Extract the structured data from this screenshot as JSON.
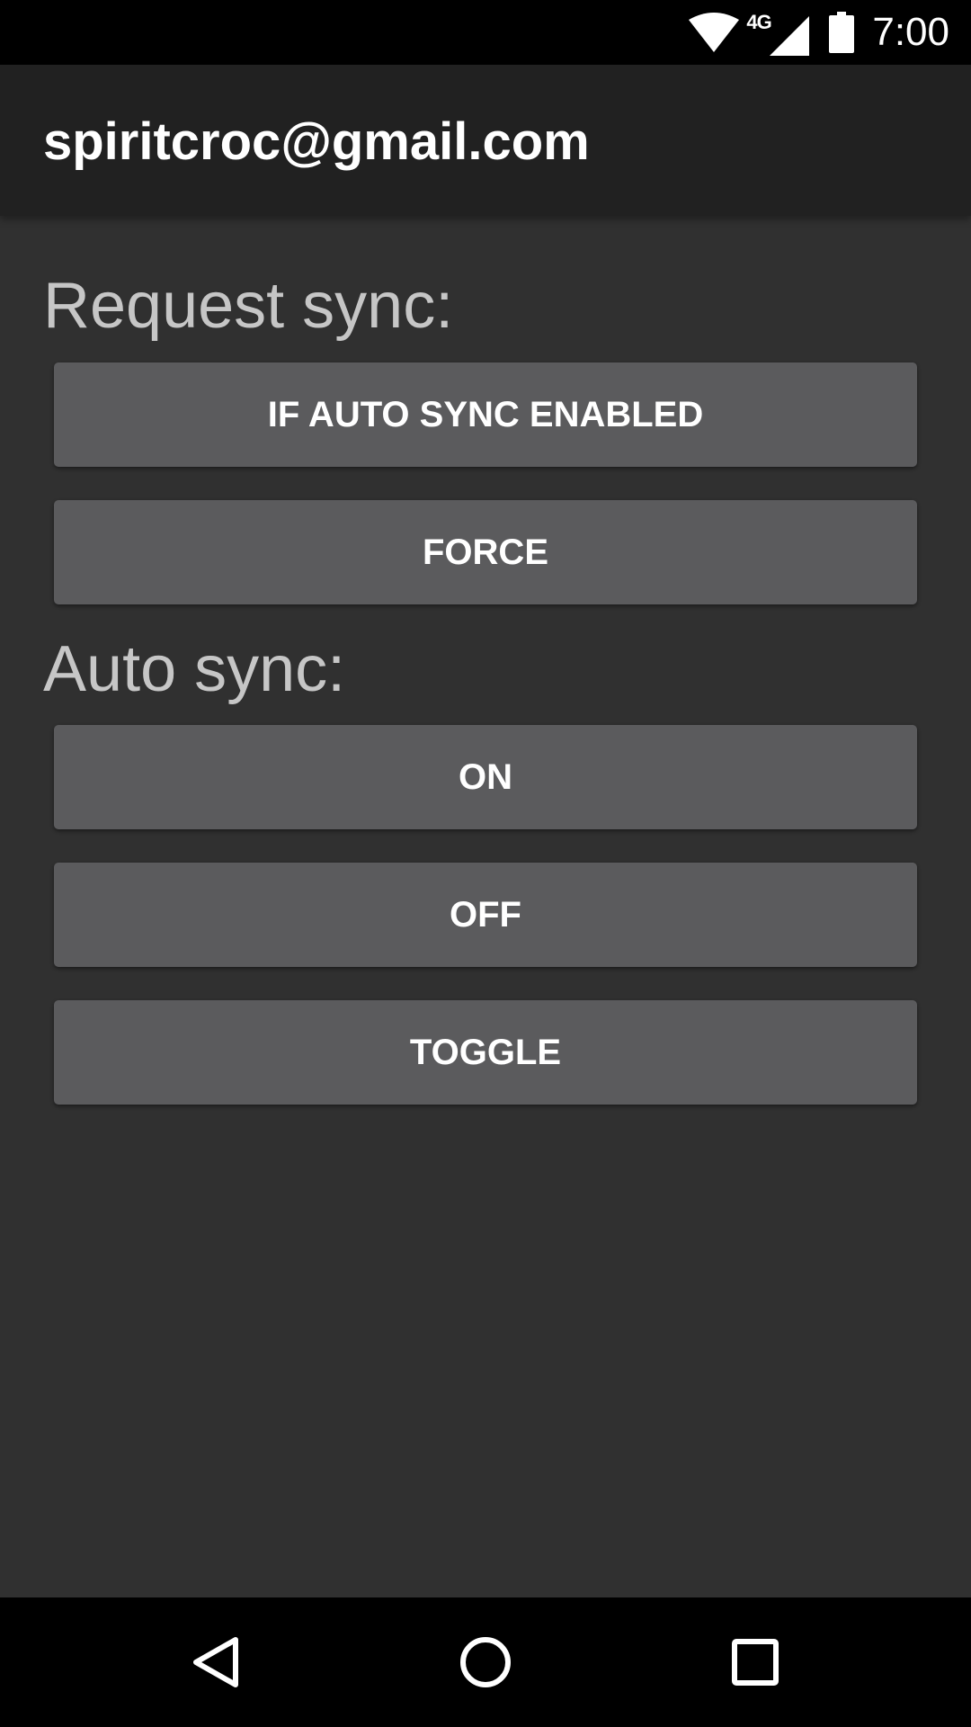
{
  "status_bar": {
    "network_type": "4G",
    "time": "7:00",
    "icons": [
      "wifi-icon",
      "cellular-signal-icon",
      "battery-icon"
    ]
  },
  "app_bar": {
    "title": "spiritcroc@gmail.com"
  },
  "request_sync": {
    "label": "Request sync:",
    "buttons": [
      "IF AUTO SYNC ENABLED",
      "FORCE"
    ]
  },
  "auto_sync": {
    "label": "Auto sync:",
    "buttons": [
      "ON",
      "OFF",
      "TOGGLE"
    ]
  },
  "nav_bar": {
    "icons": [
      "back-icon",
      "home-icon",
      "recents-icon"
    ]
  },
  "colors": {
    "background": "#303030",
    "app_bar": "#212121",
    "button": "#5b5b5d",
    "label_text": "#c6c6c6",
    "status_bar": "#000000"
  }
}
